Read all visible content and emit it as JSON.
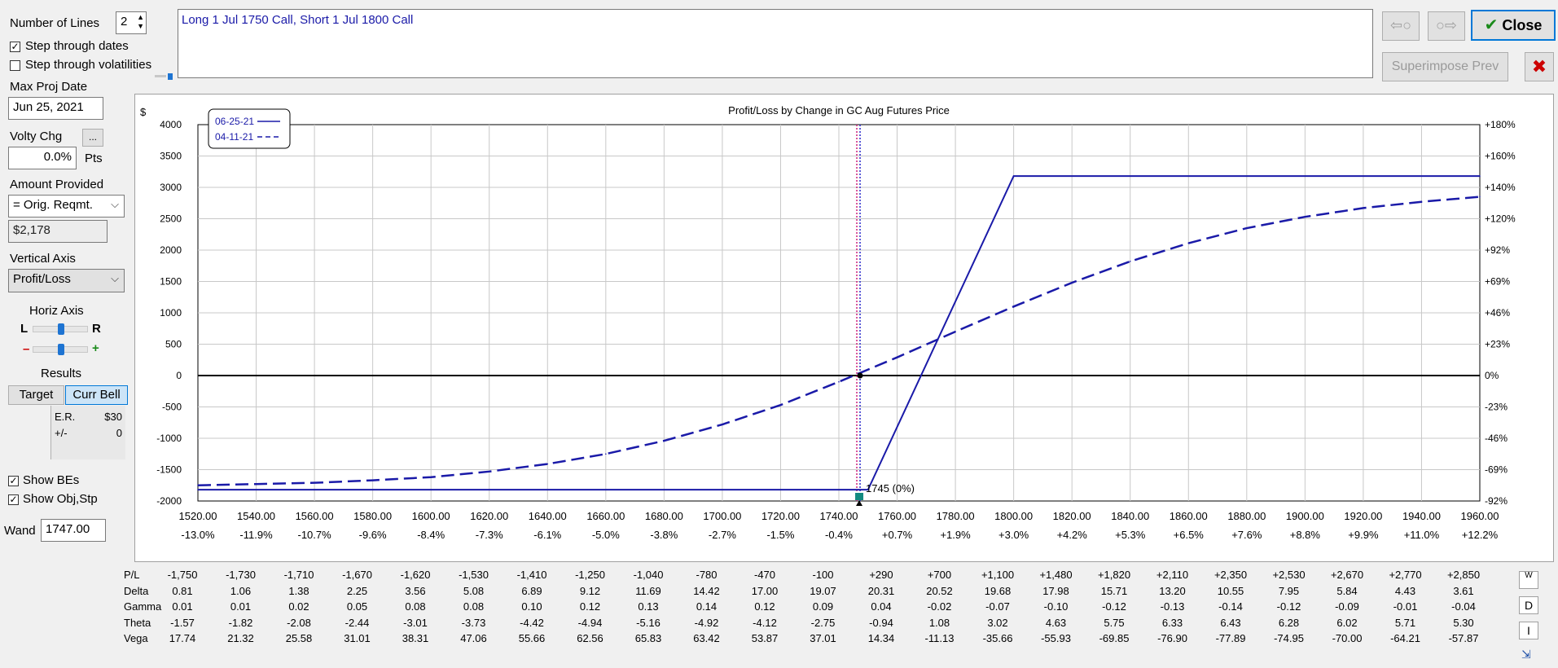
{
  "left_panel": {
    "number_of_lines_label": "Number of Lines",
    "number_of_lines_value": "2",
    "step_dates_label": "Step through dates",
    "step_dates_checked": true,
    "step_vols_label": "Step through volatilities",
    "step_vols_checked": false,
    "max_proj_date_label": "Max Proj Date",
    "max_proj_date_value": "Jun 25, 2021",
    "volty_chg_label": "Volty Chg",
    "volty_btn_label": "...",
    "volty_value": "0.0%",
    "volty_unit": "Pts",
    "amount_provided_label": "Amount Provided",
    "amount_provided_value": "= Orig. Reqmt.",
    "amount_value": "$2,178",
    "vertical_axis_label": "Vertical Axis",
    "vertical_axis_value": "Profit/Loss",
    "horiz_axis_label": "Horiz Axis",
    "horiz_l": "L",
    "horiz_r": "R",
    "horiz_minus": "–",
    "horiz_plus": "+",
    "results_label": "Results",
    "target_btn": "Target",
    "curr_bell_btn": "Curr Bell",
    "er_label": "E.R.",
    "er_value": "$30",
    "pm_label": "+/-",
    "pm_value": "0",
    "show_bes_label": "Show BEs",
    "show_bes_checked": true,
    "show_objstp_label": "Show Obj,Stp",
    "show_objstp_checked": true,
    "wand_label": "Wand",
    "wand_value": "1747.00"
  },
  "description": "Long 1 Jul 1750 Call, Short 1 Jul 1800 Call",
  "buttons": {
    "close_label": "Close",
    "superimpose_label": "Superimpose Prev"
  },
  "chart_data": {
    "type": "line",
    "title": "Profit/Loss by Change in GC Aug Futures Price",
    "ylabel": "$",
    "xlim": [
      1520,
      1960
    ],
    "ylim": [
      -2000,
      4000
    ],
    "y_ticks": [
      4000,
      3500,
      3000,
      2500,
      2000,
      1500,
      1000,
      500,
      0,
      -500,
      -1000,
      -1500,
      -2000
    ],
    "y_right_ticks": [
      "+180%",
      "+160%",
      "+140%",
      "+120%",
      "+92%",
      "+69%",
      "+46%",
      "+23%",
      "0%",
      "-23%",
      "-46%",
      "-69%",
      "-92%"
    ],
    "x_ticks": [
      "1520.00",
      "1540.00",
      "1560.00",
      "1580.00",
      "1600.00",
      "1620.00",
      "1640.00",
      "1660.00",
      "1680.00",
      "1700.00",
      "1720.00",
      "1740.00",
      "1760.00",
      "1780.00",
      "1800.00",
      "1820.00",
      "1840.00",
      "1860.00",
      "1880.00",
      "1900.00",
      "1920.00",
      "1940.00",
      "1960.00"
    ],
    "x_pct_ticks": [
      "-13.0%",
      "-11.9%",
      "-10.7%",
      "-9.6%",
      "-8.4%",
      "-7.3%",
      "-6.1%",
      "-5.0%",
      "-3.8%",
      "-2.7%",
      "-1.5%",
      "-0.4%",
      "+0.7%",
      "+1.9%",
      "+3.0%",
      "+4.2%",
      "+5.3%",
      "+6.5%",
      "+7.6%",
      "+8.8%",
      "+9.9%",
      "+11.0%",
      "+12.2%"
    ],
    "grid": true,
    "legend_position": "top-left",
    "series": [
      {
        "name": "06-25-21",
        "style": "solid",
        "x": [
          1520,
          1750,
          1800,
          1960
        ],
        "y": [
          -1820,
          -1820,
          3180,
          3180
        ]
      },
      {
        "name": "04-11-21",
        "style": "dashed",
        "x": [
          1520,
          1540,
          1560,
          1580,
          1600,
          1620,
          1640,
          1660,
          1680,
          1700,
          1720,
          1740,
          1760,
          1780,
          1800,
          1820,
          1840,
          1860,
          1880,
          1900,
          1920,
          1940,
          1960
        ],
        "y": [
          -1750,
          -1730,
          -1710,
          -1670,
          -1620,
          -1530,
          -1410,
          -1250,
          -1040,
          -780,
          -470,
          -100,
          290,
          700,
          1100,
          1480,
          1820,
          2110,
          2350,
          2530,
          2670,
          2770,
          2850
        ]
      }
    ],
    "wand_x": 1747,
    "breakeven_label": "1745 (0%)",
    "colors": {
      "line": "#1a1aa8",
      "wand": "#cc1f7a",
      "axis": "#000000"
    }
  },
  "greeks": {
    "row_labels": [
      "P/L",
      "Delta",
      "Gamma",
      "Theta",
      "Vega"
    ],
    "rows": [
      [
        "-1,750",
        "-1,730",
        "-1,710",
        "-1,670",
        "-1,620",
        "-1,530",
        "-1,410",
        "-1,250",
        "-1,040",
        "-780",
        "-470",
        "-100",
        "+290",
        "+700",
        "+1,100",
        "+1,480",
        "+1,820",
        "+2,110",
        "+2,350",
        "+2,530",
        "+2,670",
        "+2,770",
        "+2,850"
      ],
      [
        "0.81",
        "1.06",
        "1.38",
        "2.25",
        "3.56",
        "5.08",
        "6.89",
        "9.12",
        "11.69",
        "14.42",
        "17.00",
        "19.07",
        "20.31",
        "20.52",
        "19.68",
        "17.98",
        "15.71",
        "13.20",
        "10.55",
        "7.95",
        "5.84",
        "4.43",
        "3.61"
      ],
      [
        "0.01",
        "0.01",
        "0.02",
        "0.05",
        "0.08",
        "0.08",
        "0.10",
        "0.12",
        "0.13",
        "0.14",
        "0.12",
        "0.09",
        "0.04",
        "-0.02",
        "-0.07",
        "-0.10",
        "-0.12",
        "-0.13",
        "-0.14",
        "-0.12",
        "-0.09",
        "-0.01",
        "-0.04"
      ],
      [
        "-1.57",
        "-1.82",
        "-2.08",
        "-2.44",
        "-3.01",
        "-3.73",
        "-4.42",
        "-4.94",
        "-5.16",
        "-4.92",
        "-4.12",
        "-2.75",
        "-0.94",
        "1.08",
        "3.02",
        "4.63",
        "5.75",
        "6.33",
        "6.43",
        "6.28",
        "6.02",
        "5.71",
        "5.30"
      ],
      [
        "17.74",
        "21.32",
        "25.58",
        "31.01",
        "38.31",
        "47.06",
        "55.66",
        "62.56",
        "65.83",
        "63.42",
        "53.87",
        "37.01",
        "14.34",
        "-11.13",
        "-35.66",
        "-55.93",
        "-69.85",
        "-76.90",
        "-77.89",
        "-74.95",
        "-70.00",
        "-64.21",
        "-57.87"
      ]
    ],
    "side_btn_w": "W",
    "side_btn_d": "D",
    "side_btn_i": "I"
  }
}
